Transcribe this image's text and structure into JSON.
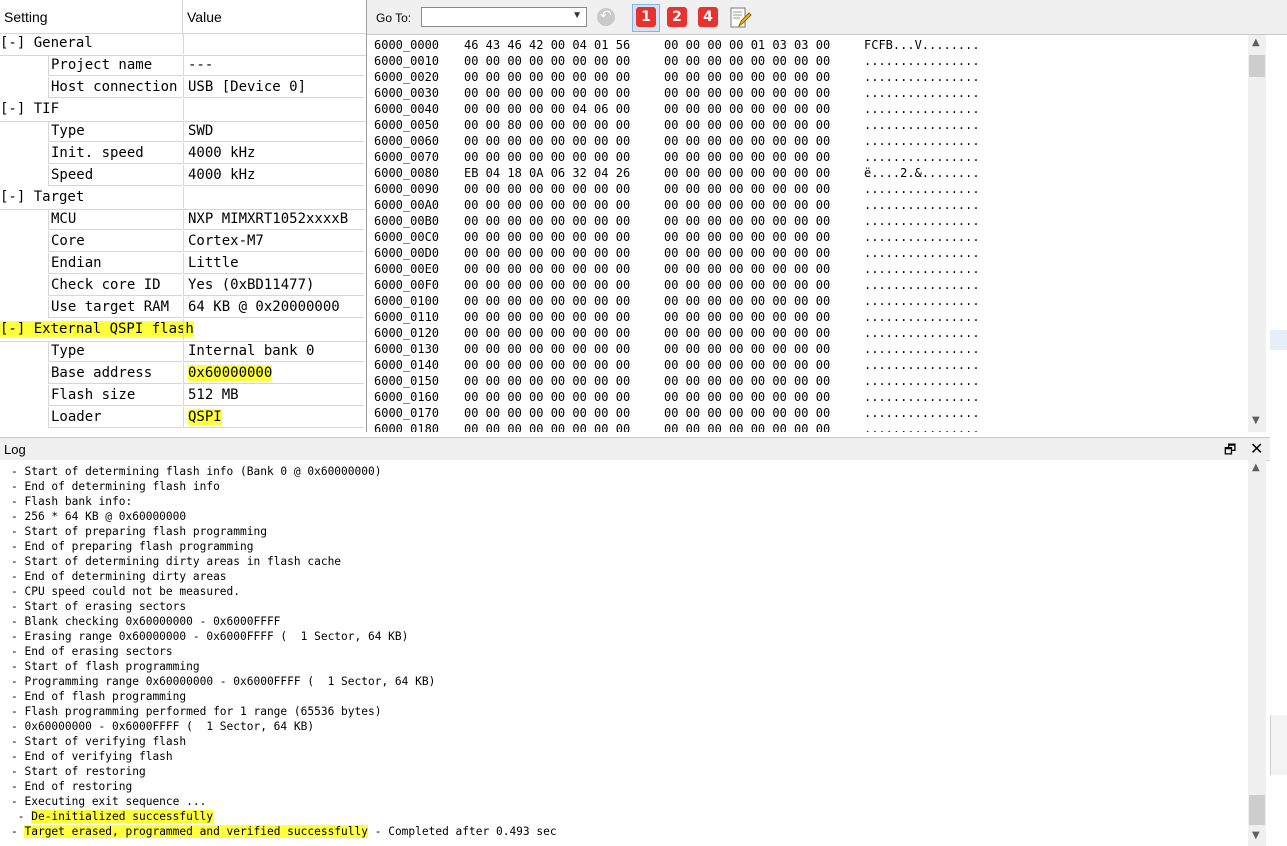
{
  "settings": {
    "header": {
      "setting": "Setting",
      "value": "Value"
    },
    "rows": [
      {
        "kind": "group",
        "label": "[-] General"
      },
      {
        "kind": "item",
        "name": "Project name",
        "value": "---"
      },
      {
        "kind": "item",
        "name": "Host connection",
        "value": "USB [Device 0]"
      },
      {
        "kind": "group",
        "label": "[-] TIF"
      },
      {
        "kind": "item",
        "name": "Type",
        "value": "SWD"
      },
      {
        "kind": "item",
        "name": "Init. speed",
        "value": "4000 kHz"
      },
      {
        "kind": "item",
        "name": "Speed",
        "value": "4000 kHz"
      },
      {
        "kind": "group",
        "label": "[-] Target"
      },
      {
        "kind": "item",
        "name": "MCU",
        "value": "NXP MIMXRT1052xxxxB"
      },
      {
        "kind": "item",
        "name": "Core",
        "value": "Cortex-M7"
      },
      {
        "kind": "item",
        "name": "Endian",
        "value": "Little"
      },
      {
        "kind": "item",
        "name": "Check core ID",
        "value": "Yes (0xBD11477)"
      },
      {
        "kind": "item",
        "name": "Use target RAM",
        "value": "64 KB @ 0x20000000"
      },
      {
        "kind": "group",
        "label": "[-] External QSPI flash",
        "highlight": true
      },
      {
        "kind": "item",
        "name": "Type",
        "value": "Internal bank 0"
      },
      {
        "kind": "item",
        "name": "Base address",
        "value": "0x60000000",
        "highlight": true
      },
      {
        "kind": "item",
        "name": "Flash size",
        "value": "512 MB"
      },
      {
        "kind": "item",
        "name": "Loader",
        "value": "QSPI",
        "highlight": true
      }
    ]
  },
  "toolbar": {
    "goto_label": "Go To:",
    "goto_value": "",
    "btn1": "1",
    "btn2": "2",
    "btn4": "4"
  },
  "memory": {
    "rows": [
      {
        "addr": "6000_0000",
        "b1": "46 43 46 42 00 04 01 56",
        "b2": "00 00 00 00 01 03 03 00",
        "ascii": "FCFB...V........"
      },
      {
        "addr": "6000_0010",
        "b1": "00 00 00 00 00 00 00 00",
        "b2": "00 00 00 00 00 00 00 00",
        "ascii": "................"
      },
      {
        "addr": "6000_0020",
        "b1": "00 00 00 00 00 00 00 00",
        "b2": "00 00 00 00 00 00 00 00",
        "ascii": "................"
      },
      {
        "addr": "6000_0030",
        "b1": "00 00 00 00 00 00 00 00",
        "b2": "00 00 00 00 00 00 00 00",
        "ascii": "................"
      },
      {
        "addr": "6000_0040",
        "b1": "00 00 00 00 00 04 06 00",
        "b2": "00 00 00 00 00 00 00 00",
        "ascii": "................"
      },
      {
        "addr": "6000_0050",
        "b1": "00 00 80 00 00 00 00 00",
        "b2": "00 00 00 00 00 00 00 00",
        "ascii": "................"
      },
      {
        "addr": "6000_0060",
        "b1": "00 00 00 00 00 00 00 00",
        "b2": "00 00 00 00 00 00 00 00",
        "ascii": "................"
      },
      {
        "addr": "6000_0070",
        "b1": "00 00 00 00 00 00 00 00",
        "b2": "00 00 00 00 00 00 00 00",
        "ascii": "................"
      },
      {
        "addr": "6000_0080",
        "b1": "EB 04 18 0A 06 32 04 26",
        "b2": "00 00 00 00 00 00 00 00",
        "ascii": "ë....2.&........"
      },
      {
        "addr": "6000_0090",
        "b1": "00 00 00 00 00 00 00 00",
        "b2": "00 00 00 00 00 00 00 00",
        "ascii": "................"
      },
      {
        "addr": "6000_00A0",
        "b1": "00 00 00 00 00 00 00 00",
        "b2": "00 00 00 00 00 00 00 00",
        "ascii": "................"
      },
      {
        "addr": "6000_00B0",
        "b1": "00 00 00 00 00 00 00 00",
        "b2": "00 00 00 00 00 00 00 00",
        "ascii": "................"
      },
      {
        "addr": "6000_00C0",
        "b1": "00 00 00 00 00 00 00 00",
        "b2": "00 00 00 00 00 00 00 00",
        "ascii": "................"
      },
      {
        "addr": "6000_00D0",
        "b1": "00 00 00 00 00 00 00 00",
        "b2": "00 00 00 00 00 00 00 00",
        "ascii": "................"
      },
      {
        "addr": "6000_00E0",
        "b1": "00 00 00 00 00 00 00 00",
        "b2": "00 00 00 00 00 00 00 00",
        "ascii": "................"
      },
      {
        "addr": "6000_00F0",
        "b1": "00 00 00 00 00 00 00 00",
        "b2": "00 00 00 00 00 00 00 00",
        "ascii": "................"
      },
      {
        "addr": "6000_0100",
        "b1": "00 00 00 00 00 00 00 00",
        "b2": "00 00 00 00 00 00 00 00",
        "ascii": "................"
      },
      {
        "addr": "6000_0110",
        "b1": "00 00 00 00 00 00 00 00",
        "b2": "00 00 00 00 00 00 00 00",
        "ascii": "................"
      },
      {
        "addr": "6000_0120",
        "b1": "00 00 00 00 00 00 00 00",
        "b2": "00 00 00 00 00 00 00 00",
        "ascii": "................"
      },
      {
        "addr": "6000_0130",
        "b1": "00 00 00 00 00 00 00 00",
        "b2": "00 00 00 00 00 00 00 00",
        "ascii": "................"
      },
      {
        "addr": "6000_0140",
        "b1": "00 00 00 00 00 00 00 00",
        "b2": "00 00 00 00 00 00 00 00",
        "ascii": "................"
      },
      {
        "addr": "6000_0150",
        "b1": "00 00 00 00 00 00 00 00",
        "b2": "00 00 00 00 00 00 00 00",
        "ascii": "................"
      },
      {
        "addr": "6000_0160",
        "b1": "00 00 00 00 00 00 00 00",
        "b2": "00 00 00 00 00 00 00 00",
        "ascii": "................"
      },
      {
        "addr": "6000_0170",
        "b1": "00 00 00 00 00 00 00 00",
        "b2": "00 00 00 00 00 00 00 00",
        "ascii": "................"
      },
      {
        "addr": "6000_0180",
        "b1": "00 00 00 00 00 00 00 00",
        "b2": "00 00 00 00 00 00 00 00",
        "ascii": "................"
      }
    ]
  },
  "log": {
    "title": "Log",
    "lines": [
      "- Start of determining flash info (Bank 0 @ 0x60000000)",
      "- End of determining flash info",
      "- Flash bank info:",
      "- 256 * 64 KB @ 0x60000000",
      "- Start of preparing flash programming",
      "- End of preparing flash programming",
      "- Start of determining dirty areas in flash cache",
      "- End of determining dirty areas",
      "- CPU speed could not be measured.",
      "- Start of erasing sectors",
      "- Blank checking 0x60000000 - 0x6000FFFF",
      "- Erasing range 0x60000000 - 0x6000FFFF (  1 Sector, 64 KB)",
      "- End of erasing sectors",
      "- Start of flash programming",
      "- Programming range 0x60000000 - 0x6000FFFF (  1 Sector, 64 KB)",
      "- End of flash programming",
      "- Flash programming performed for 1 range (65536 bytes)",
      "- 0x60000000 - 0x6000FFFF (  1 Sector, 64 KB)",
      "- Start of verifying flash",
      "- End of verifying flash",
      "- Start of restoring",
      "- End of restoring",
      "- Executing exit sequence ...",
      " - De-initialized successfully"
    ],
    "final_prefix": "- ",
    "final_highlight": "Target erased, programmed and verified successfully",
    "final_suffix": " - Completed after 0.493 sec"
  },
  "colors": {
    "highlight": "#ffff3c",
    "num_button": "#e8322e",
    "toolbar_bg": "#f0f0f0"
  },
  "icons": {
    "back": "back-arrow-icon",
    "edit": "edit-document-icon",
    "restore": "restore-window-icon",
    "close": "close-icon"
  }
}
